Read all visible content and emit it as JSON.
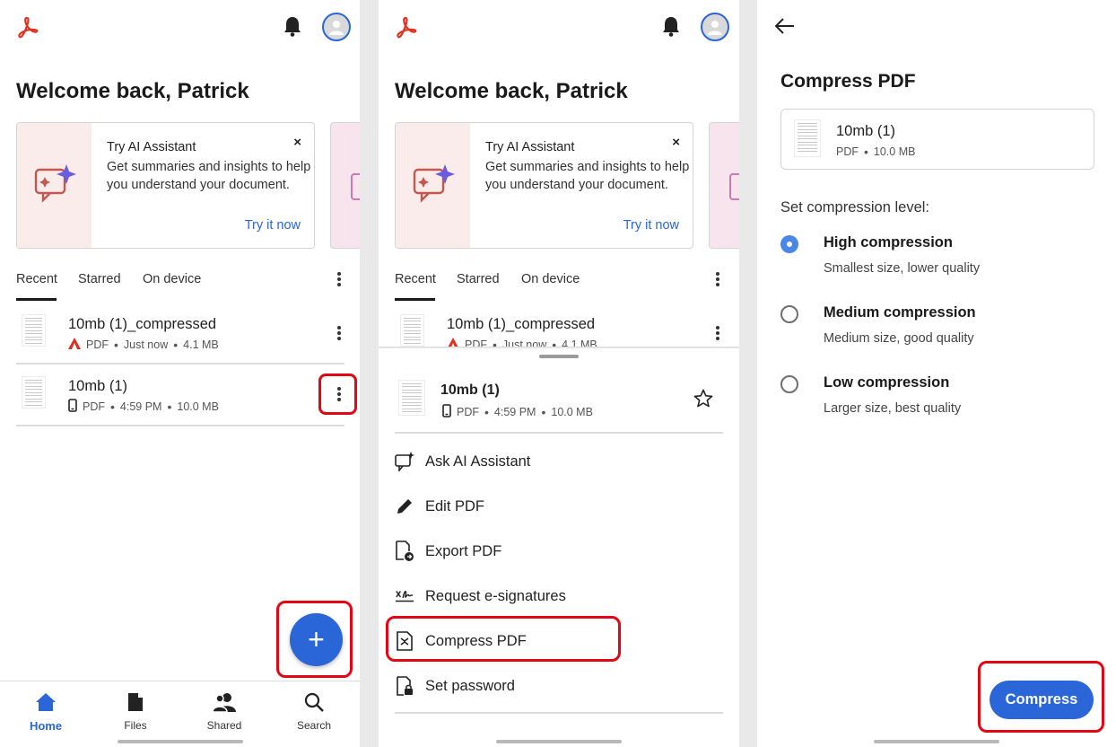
{
  "colors": {
    "accent": "#2a66d8",
    "brand_red": "#e0301e",
    "highlight": "#e30613"
  },
  "home": {
    "welcome": "Welcome back, Patrick",
    "promo": {
      "title": "Try AI Assistant",
      "body": "Get summaries and insights to help you understand your document.",
      "cta": "Try it now",
      "close": "×"
    },
    "tabs": [
      "Recent",
      "Starred",
      "On device"
    ],
    "files": [
      {
        "name": "10mb (1)_compressed",
        "type": "PDF",
        "time": "Just now",
        "size": "4.1 MB",
        "source_icon": "acrobat-pdf-icon"
      },
      {
        "name": "10mb (1)",
        "type": "PDF",
        "time": "4:59 PM",
        "size": "10.0 MB",
        "source_icon": "device-phone-icon"
      }
    ],
    "fab": "+",
    "nav": [
      "Home",
      "Files",
      "Shared",
      "Search"
    ],
    "active_nav": "Home"
  },
  "sheet": {
    "file": {
      "name": "10mb (1)",
      "type": "PDF",
      "time": "4:59 PM",
      "size": "10.0 MB"
    },
    "actions": [
      "Ask AI Assistant",
      "Edit PDF",
      "Export PDF",
      "Request e-signatures",
      "Compress PDF",
      "Set password"
    ]
  },
  "compress": {
    "title": "Compress PDF",
    "file": {
      "name": "10mb (1)",
      "type": "PDF",
      "size": "10.0 MB"
    },
    "level_label": "Set compression level:",
    "options": [
      {
        "title": "High compression",
        "subtitle": "Smallest size, lower quality",
        "selected": true
      },
      {
        "title": "Medium compression",
        "subtitle": "Medium size, good quality",
        "selected": false
      },
      {
        "title": "Low compression",
        "subtitle": "Larger size, best quality",
        "selected": false
      }
    ],
    "button": "Compress"
  }
}
